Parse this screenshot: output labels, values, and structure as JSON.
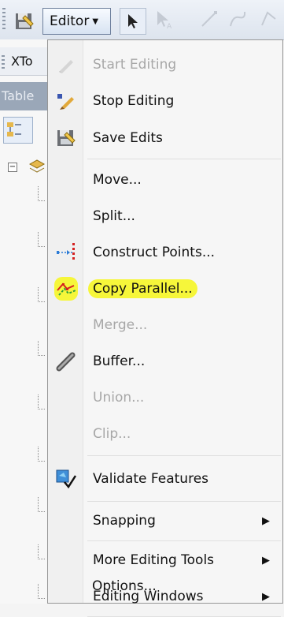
{
  "toolbar": {
    "editor_label": "Editor",
    "editor_caret": "▼"
  },
  "background": {
    "xtool_tab": "XTo",
    "table_tab": "Table",
    "tree_expander": "−"
  },
  "menu": {
    "items": [
      {
        "label": "Start Editing",
        "icon": "start-editing-icon",
        "enabled": false
      },
      {
        "label": "Stop Editing",
        "icon": "stop-editing-icon",
        "enabled": true
      },
      {
        "label": "Save Edits",
        "icon": "save-edits-icon",
        "enabled": true
      },
      {
        "label": "Move...",
        "icon": "",
        "enabled": true
      },
      {
        "label": "Split...",
        "icon": "",
        "enabled": true
      },
      {
        "label": "Construct Points...",
        "icon": "construct-points-icon",
        "enabled": true
      },
      {
        "label": "Copy Parallel...",
        "icon": "copy-parallel-icon",
        "enabled": true,
        "highlighted": true
      },
      {
        "label": "Merge...",
        "icon": "",
        "enabled": false
      },
      {
        "label": "Buffer...",
        "icon": "buffer-icon",
        "enabled": true
      },
      {
        "label": "Union...",
        "icon": "",
        "enabled": false
      },
      {
        "label": "Clip...",
        "icon": "",
        "enabled": false
      },
      {
        "label": "Validate Features",
        "icon": "validate-features-icon",
        "enabled": true
      },
      {
        "label": "Snapping",
        "icon": "",
        "enabled": true,
        "submenu": true
      },
      {
        "label": "More Editing Tools",
        "icon": "",
        "enabled": true,
        "submenu": true
      },
      {
        "label": "Editing Windows",
        "icon": "",
        "enabled": true,
        "submenu": true
      },
      {
        "label": "Options...",
        "icon": "",
        "enabled": true
      }
    ],
    "submenu_arrow": "▶",
    "highlight_color": "#f6f63a"
  }
}
